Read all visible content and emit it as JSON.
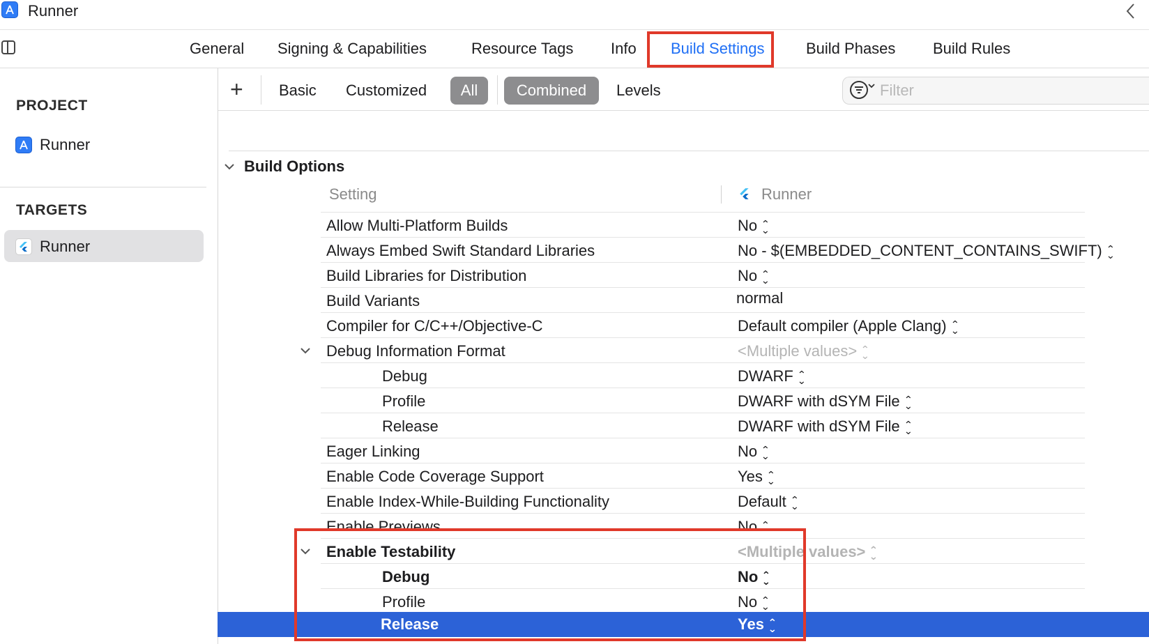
{
  "window": {
    "title": "Runner"
  },
  "tabs": [
    {
      "label": "General"
    },
    {
      "label": "Signing & Capabilities"
    },
    {
      "label": "Resource Tags"
    },
    {
      "label": "Info"
    },
    {
      "label": "Build Settings",
      "active": true
    },
    {
      "label": "Build Phases"
    },
    {
      "label": "Build Rules"
    }
  ],
  "sidebar": {
    "project_heading": "PROJECT",
    "project_item": "Runner",
    "targets_heading": "TARGETS",
    "target_item": "Runner"
  },
  "filterbar": {
    "add_label": "+",
    "basic": "Basic",
    "customized": "Customized",
    "all": "All",
    "combined": "Combined",
    "levels": "Levels",
    "filter_placeholder": "Filter"
  },
  "section": {
    "title": "Build Options",
    "col_setting": "Setting",
    "col_target": "Runner"
  },
  "rows": [
    {
      "name": "Allow Multi-Platform Builds",
      "value": "No"
    },
    {
      "name": "Always Embed Swift Standard Libraries",
      "value": "No  -  $(EMBEDDED_CONTENT_CONTAINS_SWIFT)"
    },
    {
      "name": "Build Libraries for Distribution",
      "value": "No"
    },
    {
      "name": "Build Variants",
      "value": "normal"
    },
    {
      "name": "Compiler for C/C++/Objective-C",
      "value": "Default compiler (Apple Clang)"
    },
    {
      "name": "Debug Information Format",
      "value": "<Multiple values>"
    },
    {
      "name": "Debug",
      "value": "DWARF"
    },
    {
      "name": "Profile",
      "value": "DWARF with dSYM File"
    },
    {
      "name": "Release",
      "value": "DWARF with dSYM File"
    },
    {
      "name": "Eager Linking",
      "value": "No"
    },
    {
      "name": "Enable Code Coverage Support",
      "value": "Yes"
    },
    {
      "name": "Enable Index-While-Building Functionality",
      "value": "Default"
    },
    {
      "name": "Enable Previews",
      "value": "No"
    },
    {
      "name": "Enable Testability",
      "value": "<Multiple values>"
    },
    {
      "name": "Debug",
      "value": "No"
    },
    {
      "name": "Profile",
      "value": "No"
    },
    {
      "name": "Release",
      "value": "Yes"
    }
  ],
  "colors": {
    "accent": "#1f6ff5",
    "selection": "#2c62d7",
    "highlight": "#e0392a"
  }
}
